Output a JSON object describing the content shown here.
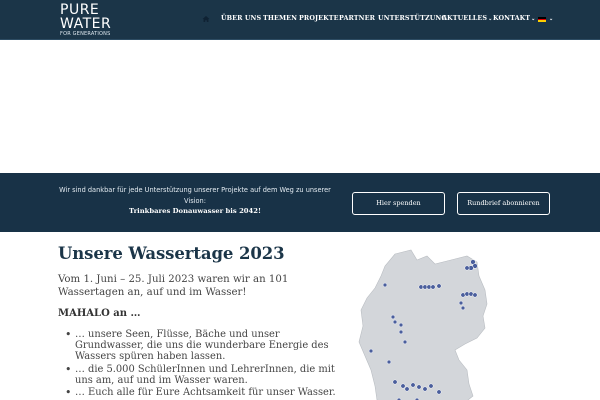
{
  "logo": {
    "line1": "PURE",
    "line2": "WATER",
    "line3": "FOR GENERATIONS"
  },
  "nav": {
    "items": [
      {
        "label": "ÜBER UNS",
        "has_caret": false
      },
      {
        "label": "THEMEN",
        "has_caret": false
      },
      {
        "label": "PROJEKTE",
        "has_caret": false
      },
      {
        "label": "PARTNER",
        "has_caret": false
      },
      {
        "label": "UNTERSTÜTZUNG",
        "has_caret": false
      },
      {
        "label": "AKTUELLES",
        "has_caret": true
      },
      {
        "label": "KONTAKT",
        "has_caret": true
      }
    ],
    "caret": "⌄",
    "language_caret": "⌄",
    "home_icon": "home-icon",
    "language_flag": "german-flag-icon"
  },
  "banner": {
    "text": "Wir sind dankbar für jede Unterstützung unserer Projekte auf dem Weg zu unserer Vision:",
    "bold": "Trinkbares Donauwasser bis 2042!",
    "button_donate": "Hier spenden",
    "button_newsletter": "Rundbrief abonnieren"
  },
  "main": {
    "title": "Unsere Wassertage 2023",
    "intro": "Vom 1. Juni – 25. Juli 2023 waren wir an 101 Wassertagen an, auf und im Wasser!",
    "mahalo": "MAHALO an …",
    "bullets": [
      "… unsere Seen, Flüsse, Bäche und unser Grundwasser, die uns die wunderbare Energie des Wassers spüren haben lassen.",
      "… die 5.000 SchülerInnen und LehrerInnen, die mit uns am, auf und im Wasser waren.",
      "… Euch alle für Eure Achtsamkeit für unser Wasser."
    ]
  },
  "colors": {
    "header_bg": "#1b3548",
    "banner_bg": "#183247",
    "title": "#1b3548",
    "map_land": "#d3d6da",
    "map_marker": "#4a5e9c"
  }
}
